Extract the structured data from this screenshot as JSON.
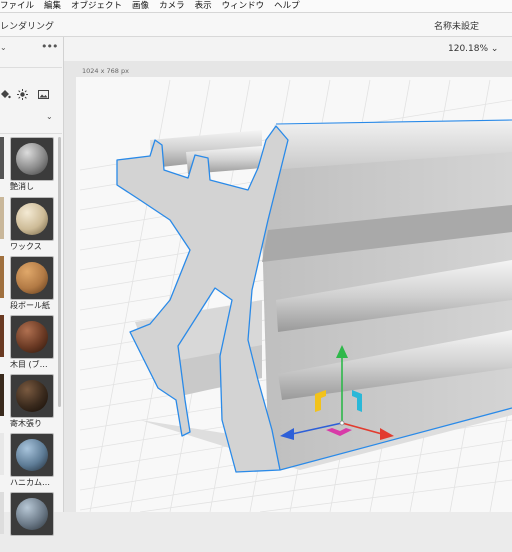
{
  "menu": [
    "ファイル",
    "編集",
    "オブジェクト",
    "画像",
    "カメラ",
    "表示",
    "ウィンドウ",
    "ヘルプ"
  ],
  "workspace": {
    "mode": "レンダリング",
    "document_title": "名称未設定"
  },
  "viewport": {
    "zoom": "120.18%",
    "chevron": "⌄",
    "canvas_size": "1024 x 768 px"
  },
  "panel": {
    "collapse_glyph": "⌄",
    "more_glyph": "•••",
    "filter_glyph": "⌄",
    "materials": [
      {
        "name": "艶消し",
        "color": "#8a8a8a"
      },
      {
        "name": "ワックス",
        "color": "#cdbb97"
      },
      {
        "name": "段ボール紙",
        "color": "#b27a45"
      },
      {
        "name": "木目 (ブ…",
        "color": "#6b3a24"
      },
      {
        "name": "寄木張り",
        "color": "#3a2a1d"
      },
      {
        "name": "ハニカム…",
        "color": "#5e7c96"
      },
      {
        "name": "",
        "color": "#6c7a88"
      }
    ]
  },
  "colors": {
    "accent": "#2a8ae8",
    "gizmo_x": "#e23b2e",
    "gizmo_y": "#2eb84a",
    "gizmo_z": "#2d5fd8",
    "gizmo_plane_yellow": "#f2c21a",
    "gizmo_plane_cyan": "#2ab8d8",
    "gizmo_plane_magenta": "#d83aa8"
  }
}
